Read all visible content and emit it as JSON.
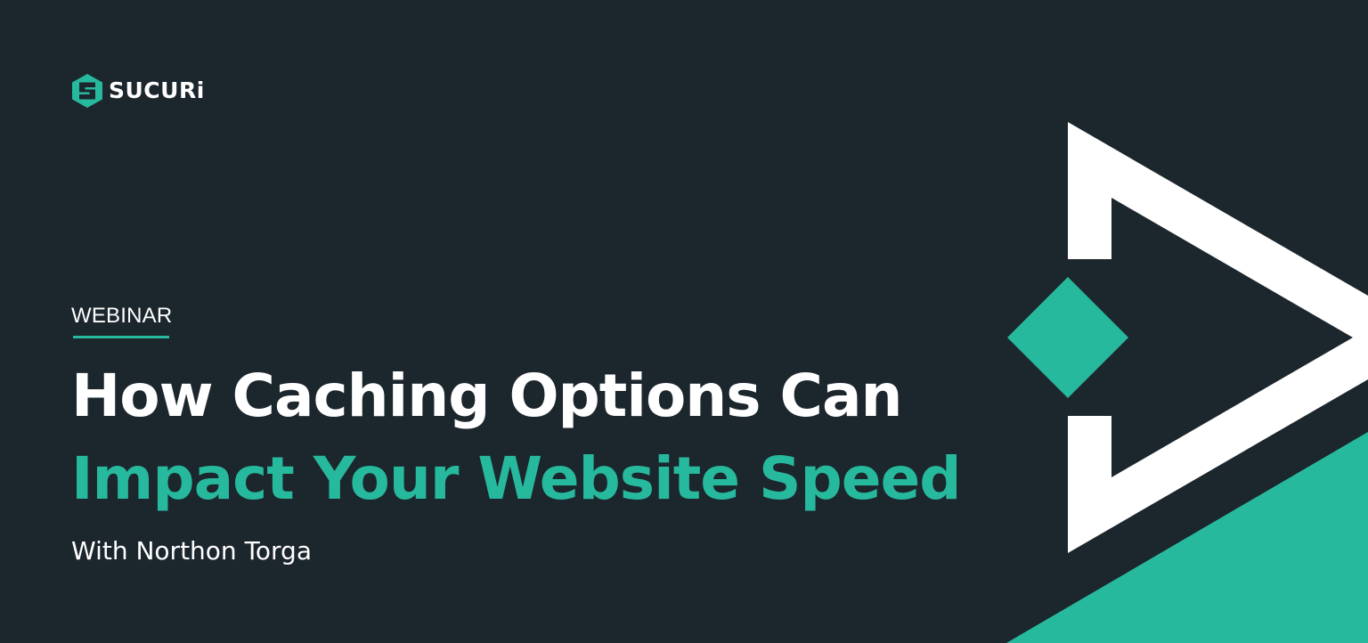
{
  "brand": {
    "name": "SUCURi",
    "logo_icon": "sucuri-hex-logo-icon",
    "accent_color": "#27b99d",
    "background_color": "#1c262d"
  },
  "eyebrow": "WEBINAR",
  "title": {
    "line1": "How Caching Options Can",
    "line2": "Impact Your Website Speed"
  },
  "presenter": "With Northon Torga",
  "decor": {
    "arrow_icon": "play-arrow-outline-icon",
    "diamond_icon": "diamond-icon"
  }
}
